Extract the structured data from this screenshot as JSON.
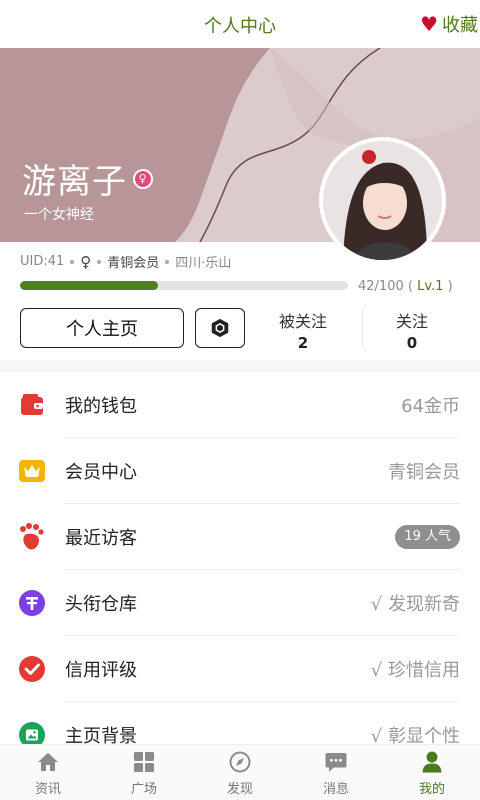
{
  "header": {
    "title": "个人中心",
    "favorites_label": "收藏"
  },
  "profile": {
    "username": "游离子",
    "gender_badge": "♀",
    "signature": "一个女神经",
    "uid": "UID:41",
    "gender": "♀",
    "member_level": "青铜会员",
    "location": "四川·乐山",
    "level_progress": 0.42,
    "progress_text": "42/100",
    "level_text": "Lv.1",
    "paren_open": "(",
    "paren_close": ")"
  },
  "actions": {
    "home_button": "个人主页",
    "hex_icon": "hexagon-icon"
  },
  "stats": {
    "followers_label": "被关注",
    "followers_value": "2",
    "following_label": "关注",
    "following_value": "0"
  },
  "menu": [
    {
      "label": "我的钱包",
      "value": "64金币",
      "icon": "wallet-icon",
      "color": "#e23b36"
    },
    {
      "label": "会员中心",
      "value": "青铜会员",
      "icon": "crown-icon",
      "color": "#f5b400"
    },
    {
      "label": "最近访客",
      "value": "19 人气",
      "icon": "footprint-icon",
      "color": "#e23b36"
    },
    {
      "label": "头衔仓库",
      "value": "√ 发现新奇",
      "icon": "title-icon",
      "color": "#7b3fe4"
    },
    {
      "label": "信用评级",
      "value": "√ 珍惜信用",
      "icon": "check-circle-icon",
      "color": "#e23b36"
    },
    {
      "label": "主页背景",
      "value": "√ 彰显个性",
      "icon": "image-icon",
      "color": "#1aa35a"
    }
  ],
  "bottom_nav": [
    {
      "label": "资讯",
      "icon": "home-icon"
    },
    {
      "label": "广场",
      "icon": "grid-icon"
    },
    {
      "label": "发现",
      "icon": "compass-icon"
    },
    {
      "label": "消息",
      "icon": "message-icon"
    },
    {
      "label": "我的",
      "icon": "user-icon",
      "active": true
    }
  ],
  "colors": {
    "accent": "#4e7a1f",
    "banner": "#b89596",
    "banner_light": "#dccbcd",
    "heart": "#c8102e"
  }
}
